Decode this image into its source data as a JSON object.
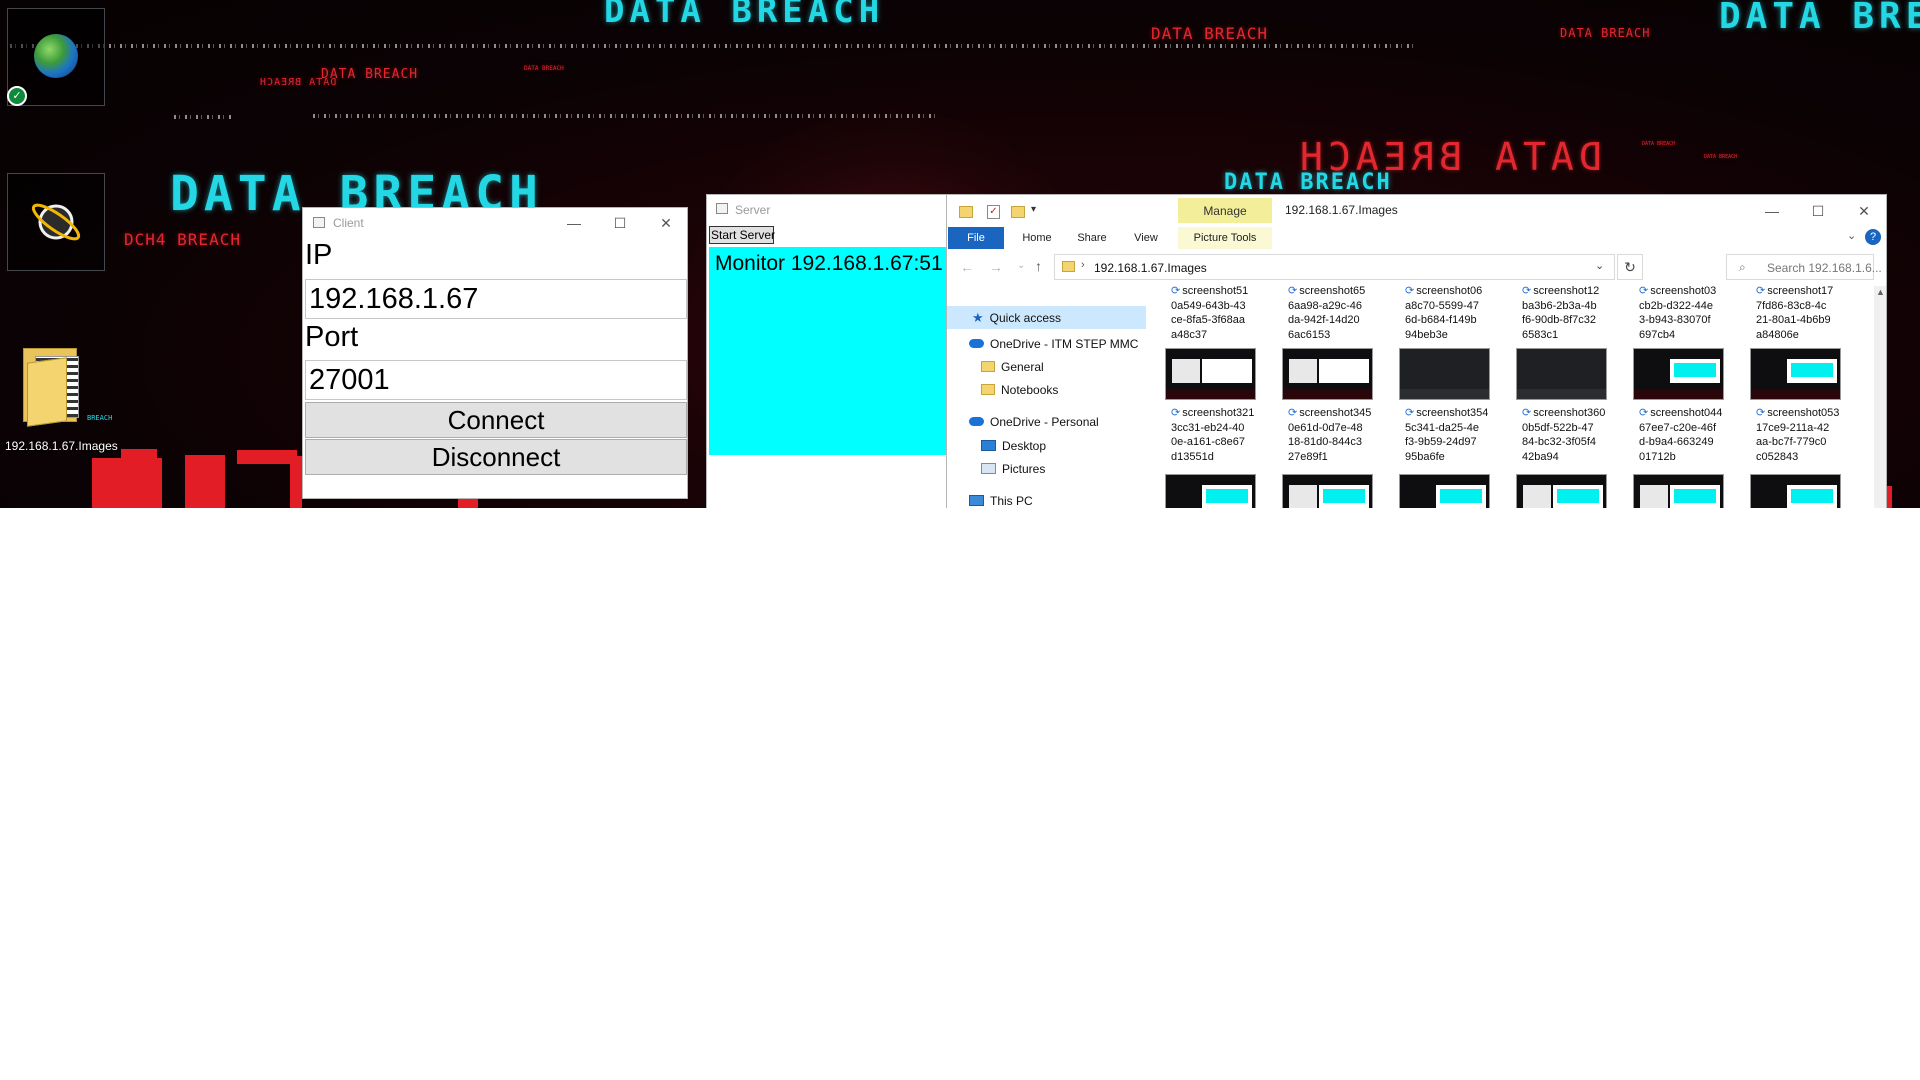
{
  "desktop": {
    "banners": [
      "DATA BREACH",
      "DATA BREACH",
      "DATA BREACH",
      "DATA BREACH",
      "DATA BREACH",
      "DATA BREACH",
      "DATA BREACH",
      "DCH4 BREACH",
      "DATA BREACH",
      "DATA BREACH",
      "DATA BREACH"
    ],
    "mirrored_banners": [
      "DATA BREACH",
      "DATA BREACH"
    ],
    "folder_icon_label": "192.168.1.67.Images",
    "folder_overlay": "BREACH",
    "icons": [
      "earth-icon",
      "planet-icon",
      "folder-icon"
    ]
  },
  "client": {
    "title": "Client",
    "ip_label": "IP",
    "ip_value": "192.168.1.67",
    "port_label": "Port",
    "port_value": "27001",
    "connect_label": "Connect",
    "disconnect_label": "Disconnect"
  },
  "server": {
    "title": "Server",
    "start_label": "Start Server",
    "monitor_text": "Monitor 192.168.1.67:51",
    "monitor_color": "#00ffff"
  },
  "explorer": {
    "title": "192.168.1.67.Images",
    "context_tab": "Manage",
    "context_group": "Picture Tools",
    "tabs": [
      "File",
      "Home",
      "Share",
      "View"
    ],
    "address": "192.168.1.67.Images",
    "search_placeholder": "Search 192.168.1.6...",
    "nav": [
      "Quick access",
      "OneDrive - ITM STEP MMC",
      "General",
      "Notebooks",
      "OneDrive - Personal",
      "Desktop",
      "Pictures",
      "This PC"
    ],
    "row1": [
      [
        "screenshot51",
        "0a549-643b-43",
        "ce-8fa5-3f68aa",
        "a48c37"
      ],
      [
        "screenshot65",
        "6aa98-a29c-46",
        "da-942f-14d20",
        "6ac6153"
      ],
      [
        "screenshot06",
        "a8c70-5599-47",
        "6d-b684-f149b",
        "94beb3e"
      ],
      [
        "screenshot12",
        "ba3b6-2b3a-4b",
        "f6-90db-8f7c32",
        "6583c1"
      ],
      [
        "screenshot03",
        "cb2b-d322-44e",
        "3-b943-83070f",
        "697cb4"
      ],
      [
        "screenshot17",
        "7fd86-83c8-4c",
        "21-80a1-4b6b9",
        "a84806e"
      ]
    ],
    "row2": [
      [
        "screenshot321",
        "3cc31-eb24-40",
        "0e-a161-c8e67",
        "d13551d"
      ],
      [
        "screenshot345",
        "0e61d-0d7e-48",
        "18-81d0-844c3",
        "27e89f1"
      ],
      [
        "screenshot354",
        "5c341-da25-4e",
        "f3-9b59-24d97",
        "95ba6fe"
      ],
      [
        "screenshot360",
        "0b5df-522b-47",
        "84-bc32-3f05f4",
        "42ba94"
      ],
      [
        "screenshot044",
        "67ee7-c20e-46f",
        "d-b9a4-663249",
        "01712b"
      ],
      [
        "screenshot053",
        "17ce9-211a-42",
        "aa-bc7f-779c0",
        "c052843"
      ]
    ]
  }
}
